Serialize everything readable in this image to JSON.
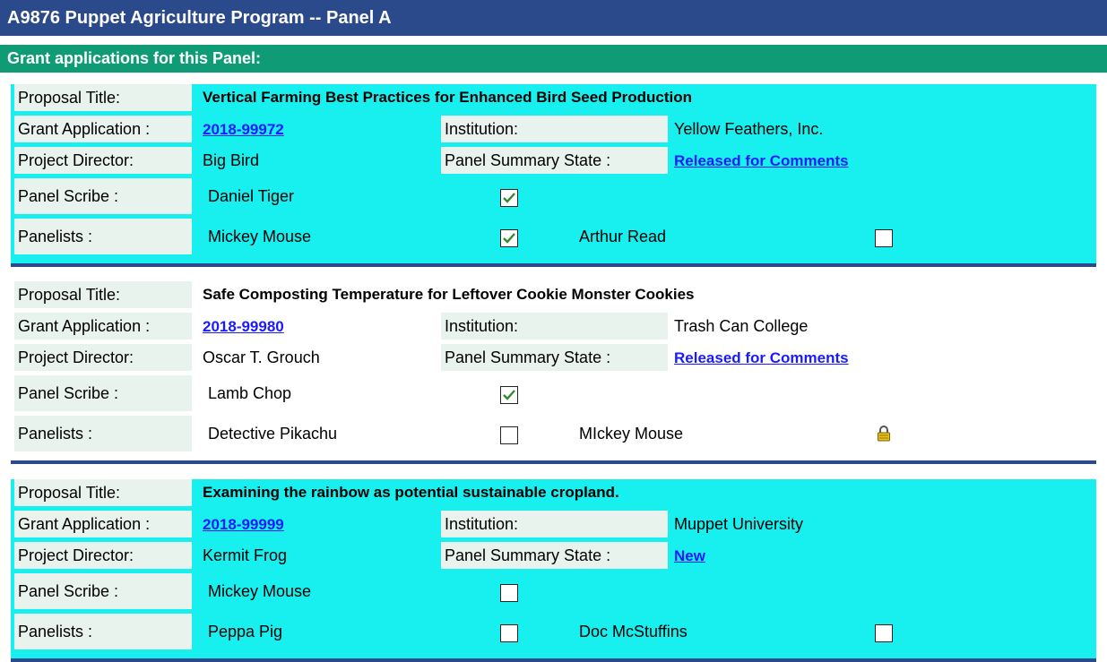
{
  "header": {
    "title": "A9876 Puppet Agriculture Program -- Panel A",
    "subtitle": "Grant applications for this Panel:"
  },
  "labels": {
    "proposal_title": "Proposal Title:",
    "grant_application": "Grant Application :",
    "institution": "Institution:",
    "project_director": "Project Director:",
    "panel_summary_state": "Panel Summary State :",
    "panel_scribe": "Panel Scribe :",
    "panelists": "Panelists :"
  },
  "proposals": [
    {
      "title": "Vertical Farming Best Practices for Enhanced Bird Seed Production",
      "grant_application": "2018-99972",
      "institution": "Yellow Feathers, Inc.",
      "project_director": "Big Bird",
      "panel_summary_state": "Released for Comments",
      "scribe": {
        "name": "Daniel Tiger",
        "checked": true
      },
      "panelists": [
        {
          "name": "Mickey Mouse",
          "status": "checked"
        },
        {
          "name": "Arthur Read",
          "status": "unchecked"
        }
      ],
      "background": "#18f0f0"
    },
    {
      "title": "Safe Composting Temperature for Leftover Cookie Monster Cookies",
      "grant_application": "2018-99980",
      "institution": "Trash Can College",
      "project_director": "Oscar T. Grouch",
      "panel_summary_state": "Released for Comments",
      "scribe": {
        "name": "Lamb Chop",
        "checked": true
      },
      "panelists": [
        {
          "name": "Detective Pikachu",
          "status": "unchecked"
        },
        {
          "name": "MIckey Mouse",
          "status": "locked"
        }
      ],
      "background": "#ffffff"
    },
    {
      "title": "Examining the rainbow as potential sustainable cropland.",
      "grant_application": "2018-99999",
      "institution": "Muppet University",
      "project_director": "Kermit Frog",
      "panel_summary_state": "New",
      "scribe": {
        "name": "Mickey Mouse",
        "checked": false
      },
      "panelists": [
        {
          "name": "Peppa Pig",
          "status": "unchecked"
        },
        {
          "name": "Doc McStuffins",
          "status": "unchecked"
        }
      ],
      "background": "#18f0f0"
    }
  ],
  "colors": {
    "title_bar": "#2b4a8c",
    "sub_bar": "#0f9b75",
    "cyan_block": "#18f0f0",
    "label_bg": "#e8f3ee",
    "link": "#1a1aff",
    "check": "#2e8b2e"
  },
  "icons": {
    "check": "checkmark-icon",
    "lock": "lock-icon"
  }
}
